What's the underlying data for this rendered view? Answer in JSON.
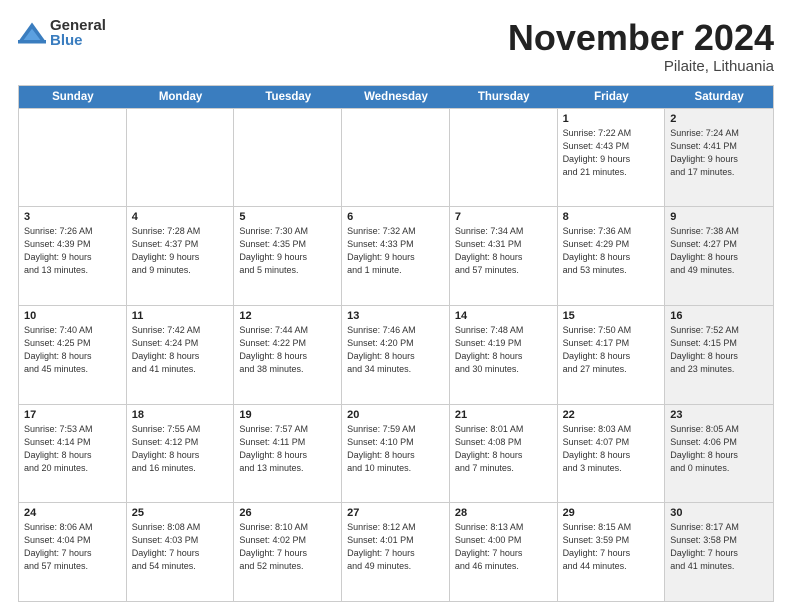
{
  "logo": {
    "general": "General",
    "blue": "Blue"
  },
  "title": {
    "month": "November 2024",
    "location": "Pilaite, Lithuania"
  },
  "header_days": [
    "Sunday",
    "Monday",
    "Tuesday",
    "Wednesday",
    "Thursday",
    "Friday",
    "Saturday"
  ],
  "weeks": [
    [
      {
        "day": "",
        "info": "",
        "shaded": false
      },
      {
        "day": "",
        "info": "",
        "shaded": false
      },
      {
        "day": "",
        "info": "",
        "shaded": false
      },
      {
        "day": "",
        "info": "",
        "shaded": false
      },
      {
        "day": "",
        "info": "",
        "shaded": false
      },
      {
        "day": "1",
        "info": "Sunrise: 7:22 AM\nSunset: 4:43 PM\nDaylight: 9 hours\nand 21 minutes.",
        "shaded": false
      },
      {
        "day": "2",
        "info": "Sunrise: 7:24 AM\nSunset: 4:41 PM\nDaylight: 9 hours\nand 17 minutes.",
        "shaded": true
      }
    ],
    [
      {
        "day": "3",
        "info": "Sunrise: 7:26 AM\nSunset: 4:39 PM\nDaylight: 9 hours\nand 13 minutes.",
        "shaded": false
      },
      {
        "day": "4",
        "info": "Sunrise: 7:28 AM\nSunset: 4:37 PM\nDaylight: 9 hours\nand 9 minutes.",
        "shaded": false
      },
      {
        "day": "5",
        "info": "Sunrise: 7:30 AM\nSunset: 4:35 PM\nDaylight: 9 hours\nand 5 minutes.",
        "shaded": false
      },
      {
        "day": "6",
        "info": "Sunrise: 7:32 AM\nSunset: 4:33 PM\nDaylight: 9 hours\nand 1 minute.",
        "shaded": false
      },
      {
        "day": "7",
        "info": "Sunrise: 7:34 AM\nSunset: 4:31 PM\nDaylight: 8 hours\nand 57 minutes.",
        "shaded": false
      },
      {
        "day": "8",
        "info": "Sunrise: 7:36 AM\nSunset: 4:29 PM\nDaylight: 8 hours\nand 53 minutes.",
        "shaded": false
      },
      {
        "day": "9",
        "info": "Sunrise: 7:38 AM\nSunset: 4:27 PM\nDaylight: 8 hours\nand 49 minutes.",
        "shaded": true
      }
    ],
    [
      {
        "day": "10",
        "info": "Sunrise: 7:40 AM\nSunset: 4:25 PM\nDaylight: 8 hours\nand 45 minutes.",
        "shaded": false
      },
      {
        "day": "11",
        "info": "Sunrise: 7:42 AM\nSunset: 4:24 PM\nDaylight: 8 hours\nand 41 minutes.",
        "shaded": false
      },
      {
        "day": "12",
        "info": "Sunrise: 7:44 AM\nSunset: 4:22 PM\nDaylight: 8 hours\nand 38 minutes.",
        "shaded": false
      },
      {
        "day": "13",
        "info": "Sunrise: 7:46 AM\nSunset: 4:20 PM\nDaylight: 8 hours\nand 34 minutes.",
        "shaded": false
      },
      {
        "day": "14",
        "info": "Sunrise: 7:48 AM\nSunset: 4:19 PM\nDaylight: 8 hours\nand 30 minutes.",
        "shaded": false
      },
      {
        "day": "15",
        "info": "Sunrise: 7:50 AM\nSunset: 4:17 PM\nDaylight: 8 hours\nand 27 minutes.",
        "shaded": false
      },
      {
        "day": "16",
        "info": "Sunrise: 7:52 AM\nSunset: 4:15 PM\nDaylight: 8 hours\nand 23 minutes.",
        "shaded": true
      }
    ],
    [
      {
        "day": "17",
        "info": "Sunrise: 7:53 AM\nSunset: 4:14 PM\nDaylight: 8 hours\nand 20 minutes.",
        "shaded": false
      },
      {
        "day": "18",
        "info": "Sunrise: 7:55 AM\nSunset: 4:12 PM\nDaylight: 8 hours\nand 16 minutes.",
        "shaded": false
      },
      {
        "day": "19",
        "info": "Sunrise: 7:57 AM\nSunset: 4:11 PM\nDaylight: 8 hours\nand 13 minutes.",
        "shaded": false
      },
      {
        "day": "20",
        "info": "Sunrise: 7:59 AM\nSunset: 4:10 PM\nDaylight: 8 hours\nand 10 minutes.",
        "shaded": false
      },
      {
        "day": "21",
        "info": "Sunrise: 8:01 AM\nSunset: 4:08 PM\nDaylight: 8 hours\nand 7 minutes.",
        "shaded": false
      },
      {
        "day": "22",
        "info": "Sunrise: 8:03 AM\nSunset: 4:07 PM\nDaylight: 8 hours\nand 3 minutes.",
        "shaded": false
      },
      {
        "day": "23",
        "info": "Sunrise: 8:05 AM\nSunset: 4:06 PM\nDaylight: 8 hours\nand 0 minutes.",
        "shaded": true
      }
    ],
    [
      {
        "day": "24",
        "info": "Sunrise: 8:06 AM\nSunset: 4:04 PM\nDaylight: 7 hours\nand 57 minutes.",
        "shaded": false
      },
      {
        "day": "25",
        "info": "Sunrise: 8:08 AM\nSunset: 4:03 PM\nDaylight: 7 hours\nand 54 minutes.",
        "shaded": false
      },
      {
        "day": "26",
        "info": "Sunrise: 8:10 AM\nSunset: 4:02 PM\nDaylight: 7 hours\nand 52 minutes.",
        "shaded": false
      },
      {
        "day": "27",
        "info": "Sunrise: 8:12 AM\nSunset: 4:01 PM\nDaylight: 7 hours\nand 49 minutes.",
        "shaded": false
      },
      {
        "day": "28",
        "info": "Sunrise: 8:13 AM\nSunset: 4:00 PM\nDaylight: 7 hours\nand 46 minutes.",
        "shaded": false
      },
      {
        "day": "29",
        "info": "Sunrise: 8:15 AM\nSunset: 3:59 PM\nDaylight: 7 hours\nand 44 minutes.",
        "shaded": false
      },
      {
        "day": "30",
        "info": "Sunrise: 8:17 AM\nSunset: 3:58 PM\nDaylight: 7 hours\nand 41 minutes.",
        "shaded": true
      }
    ]
  ]
}
